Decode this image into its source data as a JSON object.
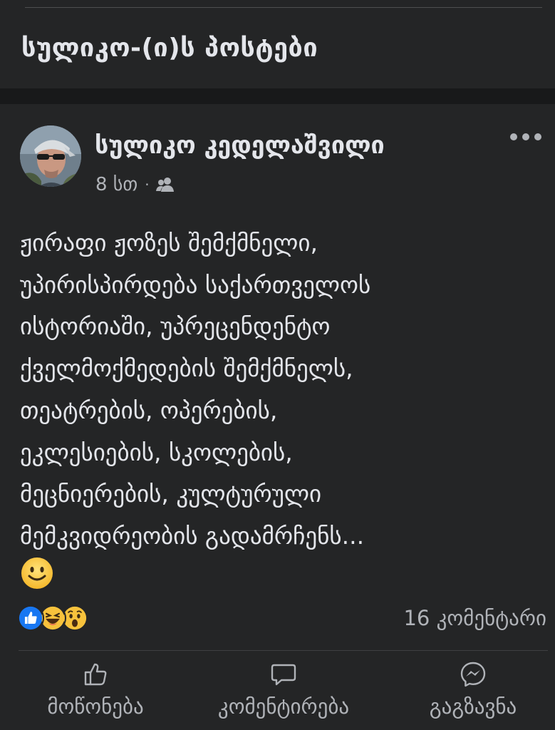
{
  "header": {
    "title": "სულიკო-(ი)ს პოსტები"
  },
  "post": {
    "author": "სულიკო კედელაშვილი",
    "time": "8 სთ",
    "audience_icon": "friends-icon",
    "text_lines": [
      "ჟირაფი ჟოზეს შემქმნელი,",
      "უპირისპირდება საქართველოს",
      "ისტორიაში, უპრეცენდენტო",
      "ქველმოქმედების შემქმნელს,",
      "თეატრების, ოპერების,",
      "ეკლესიების, სკოლების,",
      "მეცნიერების, კულტურული",
      "მემკვიდრეობის გადამრჩენს..."
    ],
    "emoji": "slightly-smiling-face",
    "reactions": [
      "like",
      "haha",
      "wow"
    ],
    "comments_count": "16 კომენტარი"
  },
  "actions": {
    "like": "მოწონება",
    "comment": "კომენტირება",
    "share": "გაგზავნა"
  },
  "colors": {
    "background": "#18191a",
    "card": "#242526",
    "text": "#e4e6eb",
    "secondary_text": "#b0b3b8",
    "like_blue": "#1877f2",
    "emoji_yellow": "#f7c23c"
  }
}
